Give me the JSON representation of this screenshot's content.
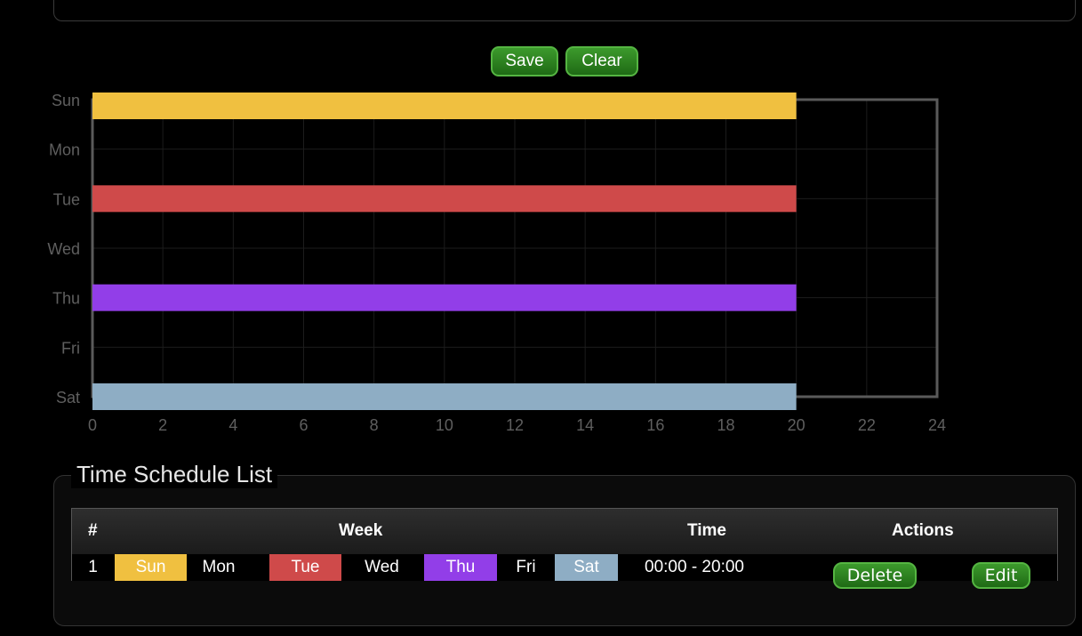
{
  "toolbar": {
    "save_label": "Save",
    "clear_label": "Clear"
  },
  "chart_data": {
    "type": "bar",
    "orientation": "horizontal",
    "categories": [
      "Sun",
      "Mon",
      "Tue",
      "Wed",
      "Thu",
      "Fri",
      "Sat"
    ],
    "xlim": [
      0,
      24
    ],
    "xticks": [
      "0",
      "2",
      "4",
      "6",
      "8",
      "10",
      "12",
      "14",
      "16",
      "18",
      "20",
      "22",
      "24"
    ],
    "grid": true,
    "bars": [
      {
        "day": "Sun",
        "start": 0,
        "end": 20,
        "color": "#f0c040"
      },
      {
        "day": "Tue",
        "start": 0,
        "end": 20,
        "color": "#cf4a4a"
      },
      {
        "day": "Thu",
        "start": 0,
        "end": 20,
        "color": "#923ee8"
      },
      {
        "day": "Sat",
        "start": 0,
        "end": 20,
        "color": "#8eadc4"
      }
    ]
  },
  "schedule_list": {
    "title": "Time Schedule List",
    "headers": {
      "index": "#",
      "week": "Week",
      "time": "Time",
      "actions": "Actions"
    },
    "rows": [
      {
        "index": "1",
        "days": [
          {
            "label": "Sun",
            "active": true,
            "color": "#f0c040"
          },
          {
            "label": "Mon",
            "active": false,
            "color": ""
          },
          {
            "label": "Tue",
            "active": true,
            "color": "#cf4a4a"
          },
          {
            "label": "Wed",
            "active": false,
            "color": ""
          },
          {
            "label": "Thu",
            "active": true,
            "color": "#923ee8"
          },
          {
            "label": "Fri",
            "active": false,
            "color": ""
          },
          {
            "label": "Sat",
            "active": true,
            "color": "#8eadc4"
          }
        ],
        "time": "00:00 - 20:00",
        "delete_label": "Delete",
        "edit_label": "Edit"
      }
    ]
  }
}
